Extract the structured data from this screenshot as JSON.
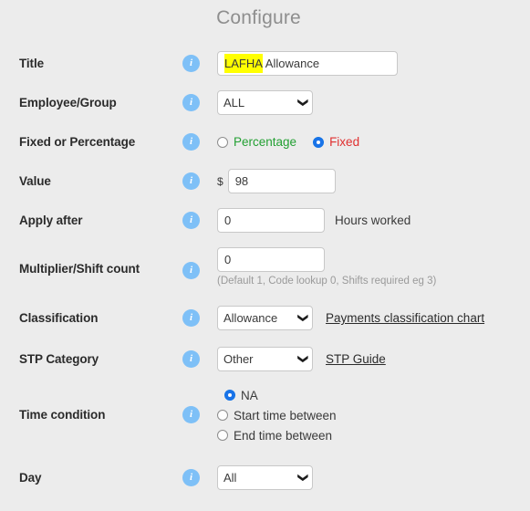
{
  "page": {
    "title": "Configure",
    "background_color": "#ececec"
  },
  "icons": {
    "info": "info-icon",
    "chevron_down": "chevron-down-icon"
  },
  "colors": {
    "info_icon": "#7ec0f7",
    "highlight": "#ffff00",
    "percentage_label": "#23a033",
    "fixed_label": "#e03030",
    "radio_checked": "#1a73e8"
  },
  "fields": {
    "title": {
      "label": "Title",
      "value": "LAFHA Allowance",
      "selected_text": "LAFHA",
      "unselected_text": " Allowance",
      "placeholder": ""
    },
    "employee_group": {
      "label": "Employee/Group",
      "value": "ALL",
      "options": [
        "ALL"
      ]
    },
    "fixed_or_percentage": {
      "label": "Fixed or Percentage",
      "options": [
        {
          "label": "Percentage",
          "checked": false
        },
        {
          "label": "Fixed",
          "checked": true
        }
      ]
    },
    "value": {
      "label": "Value",
      "prefix": "$",
      "value": "98",
      "placeholder": ""
    },
    "apply_after": {
      "label": "Apply after",
      "value": "0",
      "suffix": "Hours worked",
      "placeholder": ""
    },
    "multiplier": {
      "label": "Multiplier/Shift count",
      "value": "0",
      "hint": "(Default 1, Code lookup 0, Shifts required eg 3)",
      "placeholder": ""
    },
    "classification": {
      "label": "Classification",
      "value": "Allowance",
      "options": [
        "Allowance"
      ],
      "link": "Payments classification chart"
    },
    "stp_category": {
      "label": "STP Category",
      "value": "Other",
      "options": [
        "Other"
      ],
      "link": "STP Guide"
    },
    "time_condition": {
      "label": "Time condition",
      "options": [
        {
          "label": "NA",
          "checked": true
        },
        {
          "label": "Start time between",
          "checked": false
        },
        {
          "label": "End time between",
          "checked": false
        }
      ]
    },
    "day": {
      "label": "Day",
      "value": "All",
      "options": [
        "All"
      ]
    }
  }
}
